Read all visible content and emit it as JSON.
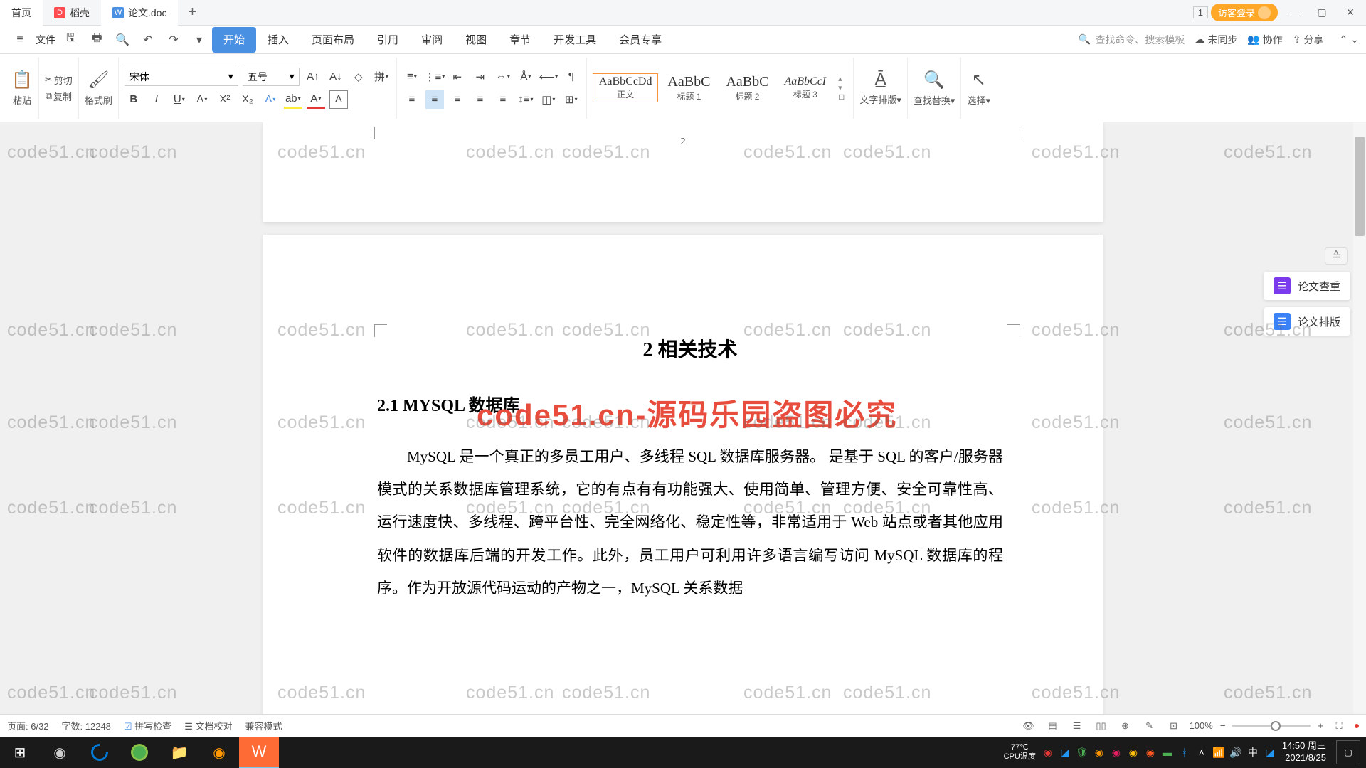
{
  "titlebar": {
    "tabs": {
      "home": "首页",
      "dao": "稻壳",
      "doc": "论文.doc"
    },
    "win_indicator": "1",
    "login": "访客登录"
  },
  "menubar": {
    "file": "文件",
    "tabs": {
      "start": "开始",
      "insert": "插入",
      "layout": "页面布局",
      "reference": "引用",
      "review": "审阅",
      "view": "视图",
      "chapter": "章节",
      "devtools": "开发工具",
      "member": "会员专享"
    },
    "search_placeholder": "查找命令、搜索模板",
    "sync": "未同步",
    "collab": "协作",
    "share": "分享"
  },
  "ribbon": {
    "cut": "剪切",
    "copy": "复制",
    "paste": "粘贴",
    "format_painter": "格式刷",
    "font_name": "宋体",
    "font_size": "五号",
    "styles": {
      "s0_preview": "AaBbCcDd",
      "s0_label": "正文",
      "s1_preview": "AaBbC",
      "s1_label": "标题 1",
      "s2_preview": "AaBbC",
      "s2_label": "标题 2",
      "s3_preview": "AaBbCcI",
      "s3_label": "标题 3"
    },
    "text_layout": "文字排版",
    "find_replace": "查找替换",
    "select": "选择"
  },
  "document": {
    "prev_page_num": "2",
    "heading_chapter": "2 相关技术",
    "heading_section": "2.1 MYSQL 数据库",
    "paragraph": "MySQL 是一个真正的多员工用户、多线程 SQL 数据库服务器。 是基于 SQL 的客户/服务器模式的关系数据库管理系统，它的有点有有功能强大、使用简单、管理方便、安全可靠性高、运行速度快、多线程、跨平台性、完全网络化、稳定性等，非常适用于 Web 站点或者其他应用软件的数据库后端的开发工作。此外，员工用户可利用许多语言编写访问 MySQL 数据库的程序。作为开放源代码运动的产物之一，MySQL 关系数据",
    "watermark_text": "code51.cn",
    "watermark_big": "code51.cn-源码乐园盗图必究"
  },
  "side_panel": {
    "check": "论文查重",
    "layout": "论文排版"
  },
  "statusbar": {
    "page": "页面: 6/32",
    "words": "字数: 12248",
    "spell": "拼写检查",
    "proofread": "文档校对",
    "compat": "兼容模式",
    "zoom": "100%"
  },
  "taskbar": {
    "temp": "77℃",
    "temp_label": "CPU温度",
    "time": "14:50 周三",
    "date": "2021/8/25",
    "ime": "中"
  }
}
